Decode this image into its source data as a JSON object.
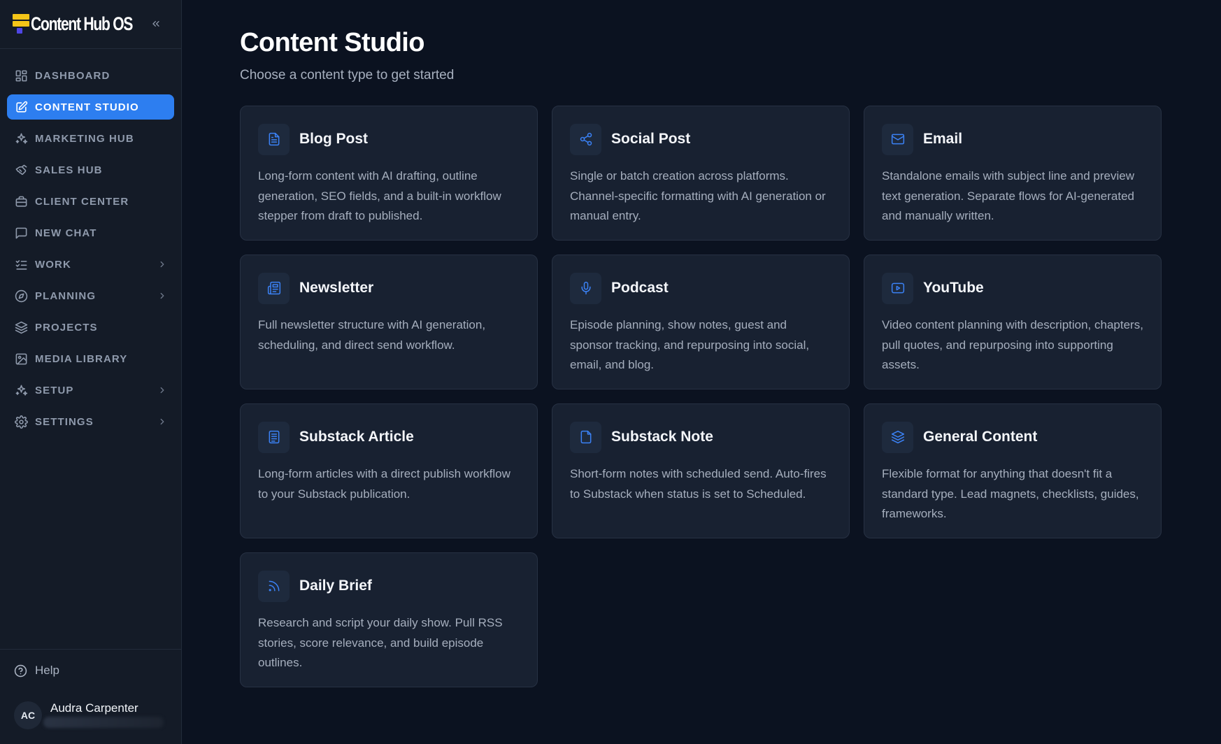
{
  "app": {
    "brand": "Content Hub OS",
    "colors": {
      "accent": "#2d7ef0",
      "logo_yellow": "#f5c518",
      "logo_blue": "#4f46e5",
      "icon_blue": "#3b82f6"
    }
  },
  "sidebar": {
    "items": [
      {
        "label": "DASHBOARD",
        "icon": "dashboard-icon",
        "active": false,
        "has_submenu": false
      },
      {
        "label": "CONTENT STUDIO",
        "icon": "edit-icon",
        "active": true,
        "has_submenu": false
      },
      {
        "label": "MARKETING HUB",
        "icon": "sparkles-icon",
        "active": false,
        "has_submenu": false
      },
      {
        "label": "SALES HUB",
        "icon": "handshake-icon",
        "active": false,
        "has_submenu": false
      },
      {
        "label": "CLIENT CENTER",
        "icon": "briefcase-icon",
        "active": false,
        "has_submenu": false
      },
      {
        "label": "NEW CHAT",
        "icon": "chat-icon",
        "active": false,
        "has_submenu": false
      },
      {
        "label": "WORK",
        "icon": "list-check-icon",
        "active": false,
        "has_submenu": true
      },
      {
        "label": "PLANNING",
        "icon": "compass-icon",
        "active": false,
        "has_submenu": true
      },
      {
        "label": "PROJECTS",
        "icon": "layers-icon",
        "active": false,
        "has_submenu": false
      },
      {
        "label": "MEDIA LIBRARY",
        "icon": "image-icon",
        "active": false,
        "has_submenu": false
      },
      {
        "label": "SETUP",
        "icon": "sparkles-icon",
        "active": false,
        "has_submenu": true
      },
      {
        "label": "SETTINGS",
        "icon": "gear-icon",
        "active": false,
        "has_submenu": true
      }
    ],
    "help_label": "Help",
    "user": {
      "initials": "AC",
      "name": "Audra Carpenter"
    }
  },
  "main": {
    "title": "Content Studio",
    "subtitle": "Choose a content type to get started",
    "cards": [
      {
        "title": "Blog Post",
        "icon": "document-icon",
        "desc": "Long-form content with AI drafting, outline generation, SEO fields, and a built-in workflow stepper from draft to published."
      },
      {
        "title": "Social Post",
        "icon": "share-icon",
        "desc": "Single or batch creation across platforms. Channel-specific formatting with AI generation or manual entry."
      },
      {
        "title": "Email",
        "icon": "mail-icon",
        "desc": "Standalone emails with subject line and preview text generation. Separate flows for AI-generated and manually written."
      },
      {
        "title": "Newsletter",
        "icon": "newspaper-icon",
        "desc": "Full newsletter structure with AI generation, scheduling, and direct send workflow."
      },
      {
        "title": "Podcast",
        "icon": "microphone-icon",
        "desc": "Episode planning, show notes, guest and sponsor tracking, and repurposing into social, email, and blog."
      },
      {
        "title": "YouTube",
        "icon": "video-icon",
        "desc": "Video content planning with description, chapters, pull quotes, and repurposing into supporting assets."
      },
      {
        "title": "Substack Article",
        "icon": "article-icon",
        "desc": "Long-form articles with a direct publish workflow to your Substack publication."
      },
      {
        "title": "Substack Note",
        "icon": "note-icon",
        "desc": "Short-form notes with scheduled send. Auto-fires to Substack when status is set to Scheduled."
      },
      {
        "title": "General Content",
        "icon": "layers-icon",
        "desc": "Flexible format for anything that doesn't fit a standard type. Lead magnets, checklists, guides, frameworks."
      },
      {
        "title": "Daily Brief",
        "icon": "rss-icon",
        "desc": "Research and script your daily show. Pull RSS stories, score relevance, and build episode outlines."
      }
    ]
  }
}
